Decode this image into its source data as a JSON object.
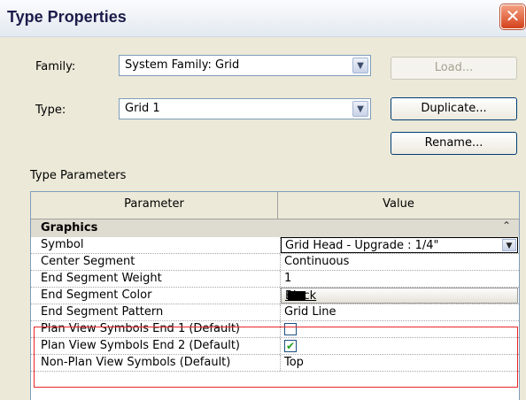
{
  "window": {
    "title": "Type Properties",
    "close_glyph": "✕"
  },
  "form": {
    "family_label": "Family:",
    "family_value": "System Family: Grid",
    "type_label": "Type:",
    "type_value": "Grid 1",
    "load_label": "Load...",
    "duplicate_label": "Duplicate...",
    "rename_label": "Rename...",
    "section_label": "Type Parameters"
  },
  "grid": {
    "header": {
      "parameter": "Parameter",
      "value": "Value"
    },
    "group": {
      "name": "Graphics",
      "collapse_glyph": "⌃"
    },
    "rows": [
      {
        "parameter": "Symbol",
        "value": "Grid Head - Upgrade : 1/4\""
      },
      {
        "parameter": "Center Segment",
        "value": "Continuous"
      },
      {
        "parameter": "End Segment Weight",
        "value": "1"
      },
      {
        "parameter": "End Segment Color",
        "value": "Black"
      },
      {
        "parameter": "End Segment Pattern",
        "value": "Grid Line"
      },
      {
        "parameter": "Plan View Symbols End 1 (Default)",
        "checked": false
      },
      {
        "parameter": "Plan View Symbols End 2 (Default)",
        "checked": true
      },
      {
        "parameter": "Non-Plan View Symbols (Default)",
        "value": "Top"
      }
    ]
  },
  "colors": {
    "highlight": "#e8262a",
    "check": "#21a121",
    "swatch": "#000000"
  }
}
